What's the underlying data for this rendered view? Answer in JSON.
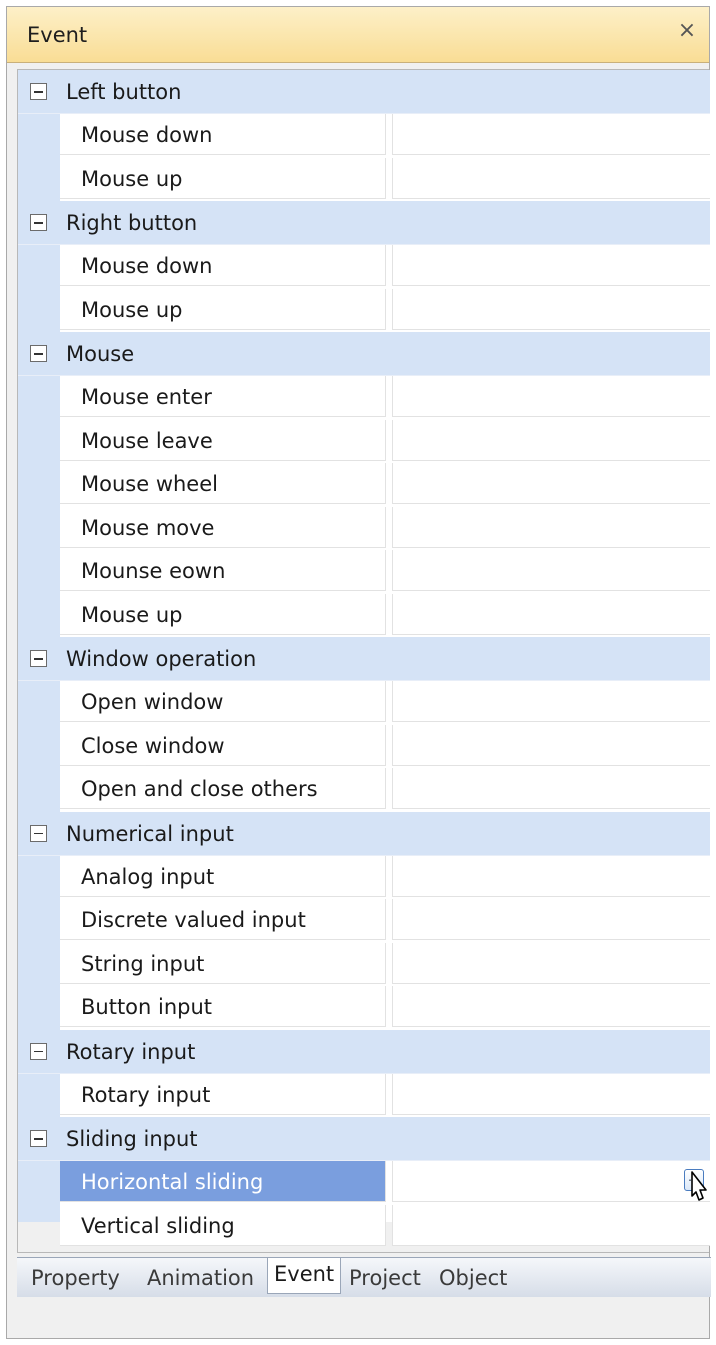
{
  "panel": {
    "title": "Event",
    "close_glyph": "×"
  },
  "categories": [
    {
      "label": "Left button",
      "items": [
        "Mouse down",
        "Mouse up"
      ]
    },
    {
      "label": "Right button",
      "items": [
        "Mouse down",
        "Mouse up"
      ]
    },
    {
      "label": "Mouse",
      "items": [
        "Mouse enter",
        "Mouse leave",
        "Mouse wheel",
        "Mouse move",
        "Mounse eown",
        "Mouse up"
      ]
    },
    {
      "label": "Window operation",
      "items": [
        "Open window",
        "Close window",
        "Open and close others"
      ]
    },
    {
      "label": "Numerical input",
      "items": [
        "Analog input",
        "Discrete valued input",
        "String input",
        "Button input"
      ]
    },
    {
      "label": "Rotary input",
      "items": [
        "Rotary input"
      ]
    },
    {
      "label": "Sliding input",
      "items": [
        "Horizontal sliding",
        "Vertical sliding"
      ]
    }
  ],
  "selected_item": "Horizontal sliding",
  "ellipsis_glyph": "…",
  "tabs": [
    {
      "label": "Property",
      "active": false
    },
    {
      "label": "Animation",
      "active": false
    },
    {
      "label": "Event",
      "active": true
    },
    {
      "label": "Project",
      "active": false
    },
    {
      "label": "Object",
      "active": false
    }
  ],
  "colors": {
    "title_bg": "#f9dd95",
    "category_bg": "#d5e3f6",
    "selected_bg": "#7a9ede"
  }
}
